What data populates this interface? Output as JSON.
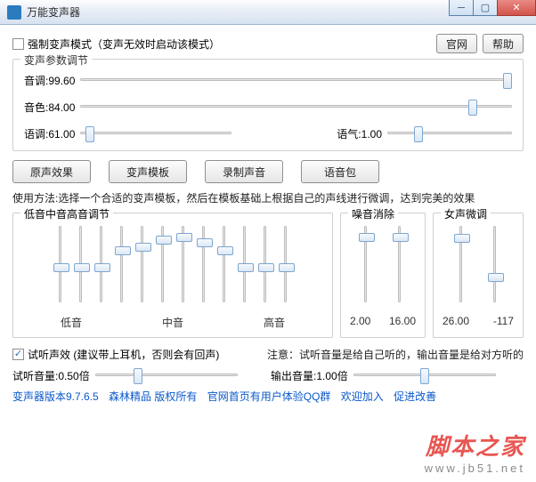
{
  "window": {
    "title": "万能变声器"
  },
  "header": {
    "force_mode_label": "强制变声模式（变声无效时启动该模式）",
    "force_mode_checked": false,
    "website_btn": "官网",
    "help_btn": "帮助"
  },
  "params": {
    "legend": "变声参数调节",
    "pitch_label": "音调:",
    "pitch_value": "99.60",
    "pitch_pos": 0.99,
    "timbre_label": "音色:",
    "timbre_value": "84.00",
    "timbre_pos": 0.91,
    "intonation_label": "语调:",
    "intonation_value": "61.00",
    "intonation_pos": 0.06,
    "tone_label": "语气:",
    "tone_value": "1.00",
    "tone_pos": 0.25
  },
  "buttons": {
    "original": "原声效果",
    "template": "变声模板",
    "record": "录制声音",
    "voicepack": "语音包"
  },
  "instruction": "使用方法:选择一个合适的变声模板，然后在模板基础上根据自己的声线进行微调，达到完美的效果",
  "eq": {
    "legend": "低音中音高音调节",
    "labels": [
      "低音",
      "中音",
      "高音"
    ],
    "positions": [
      0.55,
      0.55,
      0.55,
      0.3,
      0.25,
      0.15,
      0.1,
      0.18,
      0.3,
      0.55,
      0.55,
      0.55
    ]
  },
  "noise": {
    "legend": "噪音消除",
    "positions": [
      0.1,
      0.1
    ],
    "values": [
      "2.00",
      "16.00"
    ]
  },
  "female": {
    "legend": "女声微调",
    "positions": [
      0.12,
      0.7
    ],
    "values": [
      "26.00",
      "-117"
    ]
  },
  "listen": {
    "checkbox_label": "试听声效 (建议带上耳机，否则会有回声)",
    "checked": true,
    "note": "注意：试听音量是给自己听的，输出音量是给对方听的",
    "preview_label": "试听音量:",
    "preview_value": "0.50倍",
    "preview_pos": 0.3,
    "output_label": "输出音量:",
    "output_value": "1.00倍",
    "output_pos": 0.5
  },
  "footer": {
    "version": "变声器版本9.7.6.5",
    "copyright": "森林精品 版权所有",
    "qq": "官网首页有用户体验QQ群",
    "welcome": "欢迎加入",
    "improve": "促进改善"
  },
  "watermark": {
    "cn": "脚本之家",
    "url": "www.jb51.net"
  }
}
